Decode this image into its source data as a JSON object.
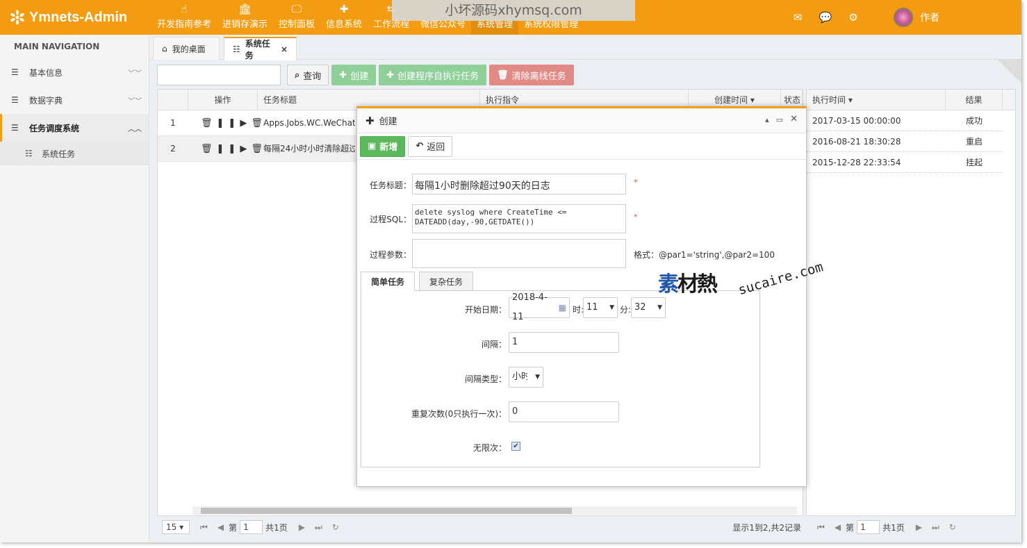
{
  "app": {
    "title": "Ymnets-Admin"
  },
  "nav": {
    "items": [
      {
        "label": "开发指南参考",
        "icon": "hand-pointer-icon"
      },
      {
        "label": "进销存演示",
        "icon": "bank-icon"
      },
      {
        "label": "控制面板",
        "icon": "monitor-icon"
      },
      {
        "label": "信息系统",
        "icon": "puzzle-icon"
      },
      {
        "label": "工作流程",
        "icon": "flow-icon"
      },
      {
        "label": "微信公众号",
        "icon": "wechat-icon"
      },
      {
        "label": "系统管理",
        "icon": "gear-icon"
      },
      {
        "label": "系统权限管理",
        "icon": "lock-icon"
      }
    ]
  },
  "watermark": "小坏源码xhymsq.com",
  "header": {
    "user": "作者"
  },
  "sidebar": {
    "heading": "MAIN NAVIGATION",
    "items": [
      {
        "label": "基本信息"
      },
      {
        "label": "数据字典"
      },
      {
        "label": "任务调度系统"
      }
    ],
    "sub_items": [
      {
        "label": "系统任务"
      }
    ]
  },
  "tabs": [
    {
      "label": "我的桌面"
    },
    {
      "label": "系统任务"
    }
  ],
  "toolbar": {
    "query": "查询",
    "create": "创建",
    "create_auto": "创建程序自执行任务",
    "clear_offline": "清除离线任务"
  },
  "grid": {
    "headers": [
      "操作",
      "任务标题",
      "执行指令",
      "创建时间",
      "状态"
    ],
    "rows": [
      {
        "num": "1",
        "title": "Apps.Jobs.WC.WeChatG"
      },
      {
        "num": "2",
        "title": "每隔24小时小时清除超过"
      }
    ],
    "pager": {
      "size": "15",
      "page_label": "第",
      "page": "1",
      "total": "共1页",
      "summary": "显示1到2,共2记录"
    }
  },
  "right_grid": {
    "headers": [
      "执行时间",
      "结果"
    ],
    "rows": [
      {
        "time": "2017-03-15 00:00:00",
        "result": "成功"
      },
      {
        "time": "2016-08-21 18:30:28",
        "result": "重启"
      },
      {
        "time": "2015-12-28 22:33:54",
        "result": "挂起"
      }
    ],
    "pager": {
      "page_label": "第",
      "page": "1",
      "total": "共1页"
    }
  },
  "modal": {
    "title": "创建",
    "save": "新增",
    "back": "返回",
    "fields": {
      "title_label": "任务标题：",
      "title_value": "每隔1小时删除超过90天的日志",
      "sql_label": "过程SQL：",
      "sql_value": "delete syslog where CreateTime <= DATEADD(day,-90,GETDATE())",
      "params_label": "过程参数：",
      "params_value": "",
      "params_hint": "格式：@par1='string',@par2=100",
      "required": "*"
    },
    "subtabs": [
      "简单任务",
      "复杂任务"
    ],
    "simple": {
      "start_label": "开始日期：",
      "start_value": "2018-4-11",
      "hour_label": "时:",
      "hour_value": "11",
      "minute_label": "分:",
      "minute_value": "32",
      "interval_label": "间隔：",
      "interval_value": "1",
      "interval_type_label": "间隔类型：",
      "interval_type_value": "小时",
      "repeat_label": "重复次数(0只执行一次)：",
      "repeat_value": "0",
      "unlimited_label": "无限次：",
      "unlimited_checked": true
    }
  },
  "watermark2": {
    "cn1": "素",
    "cn2": "材熱",
    "en": "sucaire.com"
  },
  "colors": {
    "header": "#f39c12",
    "nav_active": "#e08e0b",
    "btn_green": "#8fcf98",
    "btn_red": "#e28b86",
    "save_green": "#5cb85c"
  }
}
